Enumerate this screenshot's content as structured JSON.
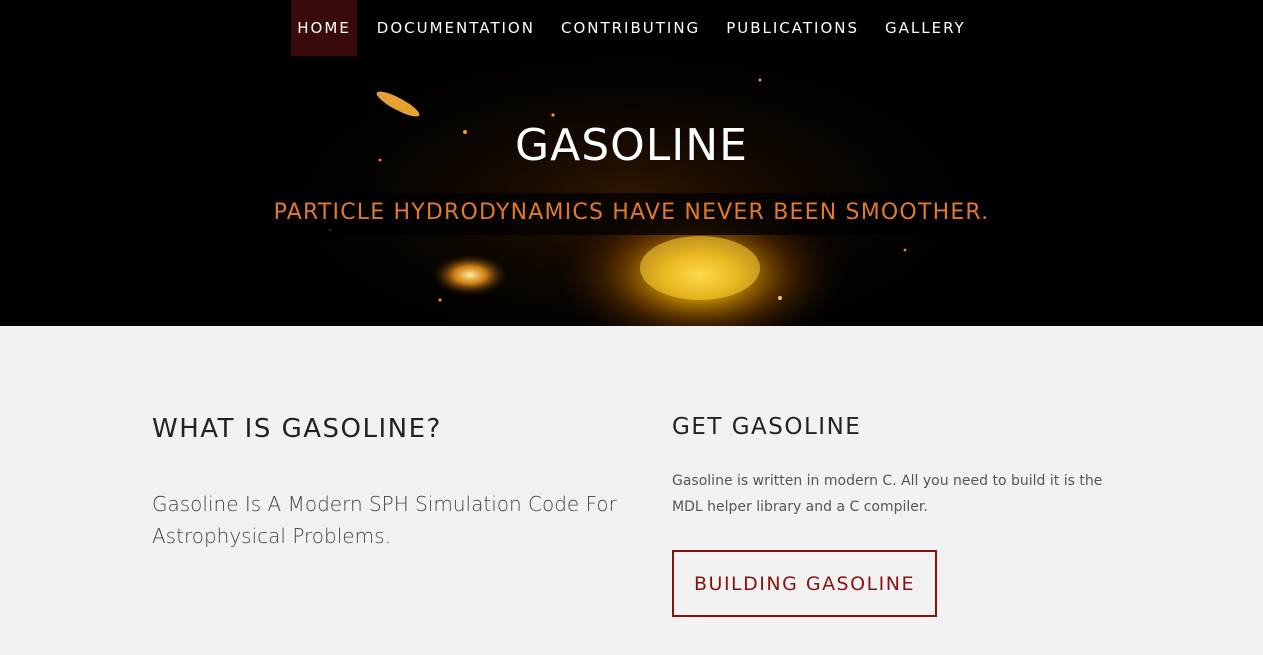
{
  "nav": {
    "items": [
      {
        "label": "HOME",
        "active": true
      },
      {
        "label": "DOCUMENTATION",
        "active": false
      },
      {
        "label": "CONTRIBUTING",
        "active": false
      },
      {
        "label": "PUBLICATIONS",
        "active": false
      },
      {
        "label": "GALLERY",
        "active": false
      }
    ]
  },
  "hero": {
    "title": "GASOLINE",
    "tagline": "PARTICLE HYDRODYNAMICS HAVE NEVER BEEN SMOOTHER."
  },
  "about": {
    "heading": "WHAT IS GASOLINE?",
    "lede": "Gasoline Is A Modern SPH Simulation Code For Astrophysical Problems."
  },
  "get": {
    "heading": "GET GASOLINE",
    "description": "Gasoline is written in modern C. All you need to build it is the MDL helper library and a C compiler.",
    "button_label": "BUILDING GASOLINE"
  },
  "colors": {
    "accent": "#8b1111",
    "tagline": "#e07a2a",
    "nav_active_bg": "#3a0a0a",
    "page_bg": "#f2f2f2"
  }
}
